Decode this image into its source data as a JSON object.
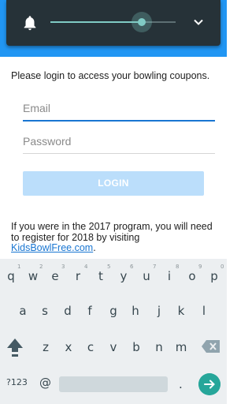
{
  "volume": {
    "level_percent": 73
  },
  "login": {
    "intro": "Please login to access your bowling coupons.",
    "email_placeholder": "Email",
    "password_placeholder": "Password",
    "button_label": "LOGIN",
    "note_text": "If you were in the 2017 program, you will need to register for 2018 by visiting ",
    "note_link": "KidsBowlFree.com",
    "note_end": "."
  },
  "keyboard": {
    "row1": [
      "q",
      "w",
      "e",
      "r",
      "t",
      "y",
      "u",
      "i",
      "o",
      "p"
    ],
    "row1_hints": [
      "1",
      "2",
      "3",
      "4",
      "5",
      "6",
      "7",
      "8",
      "9",
      "0"
    ],
    "row2": [
      "a",
      "s",
      "d",
      "f",
      "g",
      "h",
      "j",
      "k",
      "l"
    ],
    "row3": [
      "z",
      "x",
      "c",
      "v",
      "b",
      "n",
      "m"
    ],
    "symbols_label": "?123",
    "at_label": "@",
    "period_label": "."
  },
  "colors": {
    "header_blue": "#2196f3",
    "panel_dark": "#263238",
    "accent_teal": "#80cbc4",
    "go_button": "#26a69a",
    "link_blue": "#1976d2"
  }
}
